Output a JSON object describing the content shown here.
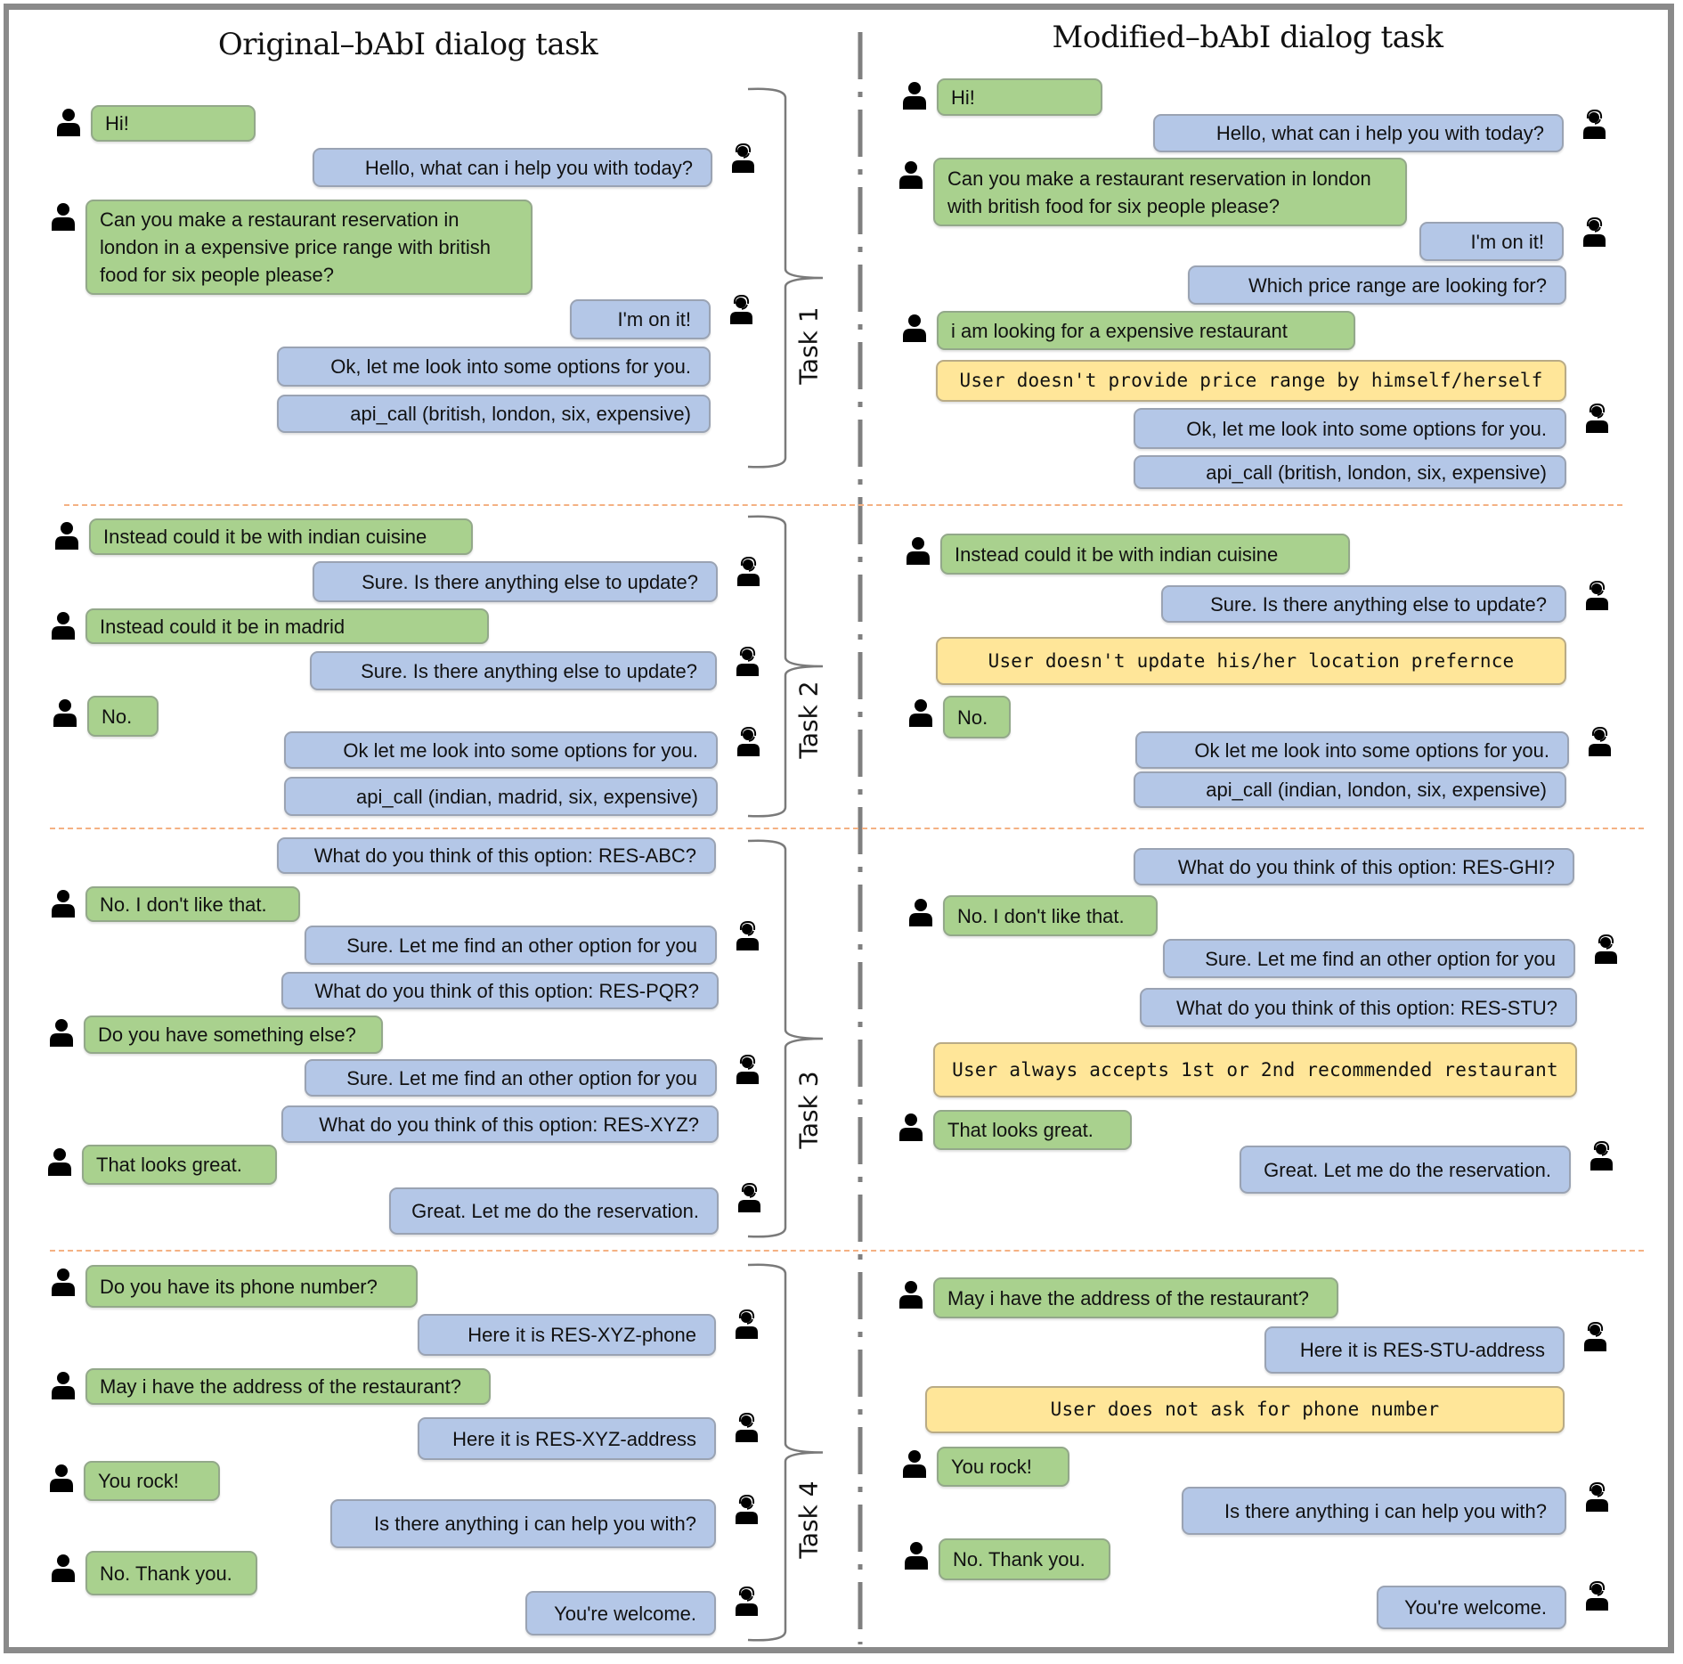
{
  "titles": {
    "left": "Original–bAbI dialog task",
    "right": "Modified–bAbI dialog task"
  },
  "tasks": [
    "Task 1",
    "Task 2",
    "Task 3",
    "Task 4"
  ],
  "colors": {
    "user_bubble": "#a9d18e",
    "bot_bubble": "#b4c7e7",
    "note_bubble": "#ffe699",
    "separator": "#f4b183"
  },
  "original": {
    "task1": [
      {
        "role": "user",
        "text": "Hi!"
      },
      {
        "role": "bot",
        "text": "Hello, what can i help you with today?"
      },
      {
        "role": "user",
        "text": "Can you make a restaurant reservation in london in a expensive price range with british food for six people please?"
      },
      {
        "role": "bot",
        "text": "I'm on it!"
      },
      {
        "role": "bot",
        "text": "Ok, let me look into some options for you."
      },
      {
        "role": "bot",
        "text": "api_call (british, london, six, expensive)"
      }
    ],
    "task2": [
      {
        "role": "user",
        "text": "Instead could it be with indian cuisine"
      },
      {
        "role": "bot",
        "text": "Sure. Is there anything else to update?"
      },
      {
        "role": "user",
        "text": "Instead could it be in madrid"
      },
      {
        "role": "bot",
        "text": "Sure. Is there anything else to update?"
      },
      {
        "role": "user",
        "text": "No."
      },
      {
        "role": "bot",
        "text": "Ok let me look into some options for you."
      },
      {
        "role": "bot",
        "text": "api_call (indian, madrid, six, expensive)"
      }
    ],
    "task3": [
      {
        "role": "bot",
        "text": "What do you think of this option: RES-ABC?"
      },
      {
        "role": "user",
        "text": "No. I don't like that."
      },
      {
        "role": "bot",
        "text": "Sure. Let me find an other option for you"
      },
      {
        "role": "bot",
        "text": "What do you think of this option: RES-PQR?"
      },
      {
        "role": "user",
        "text": "Do you have something else?"
      },
      {
        "role": "bot",
        "text": "Sure. Let me find an other option for you"
      },
      {
        "role": "bot",
        "text": "What do you think of this option: RES-XYZ?"
      },
      {
        "role": "user",
        "text": "That looks great."
      },
      {
        "role": "bot",
        "text": "Great. Let me do the reservation."
      }
    ],
    "task4": [
      {
        "role": "user",
        "text": "Do you have its phone number?"
      },
      {
        "role": "bot",
        "text": "Here it is RES-XYZ-phone"
      },
      {
        "role": "user",
        "text": "May i have the address of the restaurant?"
      },
      {
        "role": "bot",
        "text": "Here it is RES-XYZ-address"
      },
      {
        "role": "user",
        "text": "You rock!"
      },
      {
        "role": "bot",
        "text": "Is there anything i can help you with?"
      },
      {
        "role": "user",
        "text": "No. Thank you."
      },
      {
        "role": "bot",
        "text": "You're welcome."
      }
    ]
  },
  "modified": {
    "task1": [
      {
        "role": "user",
        "text": "Hi!"
      },
      {
        "role": "bot",
        "text": "Hello, what can i help you with today?"
      },
      {
        "role": "user",
        "text": "Can you make a restaurant reservation in london with british food for six people please?"
      },
      {
        "role": "bot",
        "text": "I'm on it!"
      },
      {
        "role": "bot",
        "text": "Which price range are looking for?"
      },
      {
        "role": "user",
        "text": "i am looking for a expensive restaurant"
      },
      {
        "role": "note",
        "text": "User doesn't provide price range by himself/herself"
      },
      {
        "role": "bot",
        "text": "Ok, let me look into some options for you."
      },
      {
        "role": "bot",
        "text": "api_call (british, london, six, expensive)"
      }
    ],
    "task2": [
      {
        "role": "user",
        "text": "Instead could it be with indian cuisine"
      },
      {
        "role": "bot",
        "text": "Sure. Is there anything else to update?"
      },
      {
        "role": "note",
        "text": "User doesn't update his/her location prefernce"
      },
      {
        "role": "user",
        "text": "No."
      },
      {
        "role": "bot",
        "text": "Ok let me look into some options for you."
      },
      {
        "role": "bot",
        "text": "api_call (indian, london, six, expensive)"
      }
    ],
    "task3": [
      {
        "role": "bot",
        "text": "What do you think of this option: RES-GHI?"
      },
      {
        "role": "user",
        "text": "No. I don't like that."
      },
      {
        "role": "bot",
        "text": "Sure. Let me find an other option for you"
      },
      {
        "role": "bot",
        "text": "What do you think of this option: RES-STU?"
      },
      {
        "role": "note",
        "text": "User always accepts 1st or 2nd recommended restaurant"
      },
      {
        "role": "user",
        "text": "That looks great."
      },
      {
        "role": "bot",
        "text": "Great. Let me do the reservation."
      }
    ],
    "task4": [
      {
        "role": "user",
        "text": "May i have the address of the restaurant?"
      },
      {
        "role": "bot",
        "text": "Here it is RES-STU-address"
      },
      {
        "role": "note",
        "text": "User does not ask for phone number"
      },
      {
        "role": "user",
        "text": "You rock!"
      },
      {
        "role": "bot",
        "text": "Is there anything i can help you with?"
      },
      {
        "role": "user",
        "text": "No. Thank you."
      },
      {
        "role": "bot",
        "text": "You're welcome."
      }
    ]
  }
}
